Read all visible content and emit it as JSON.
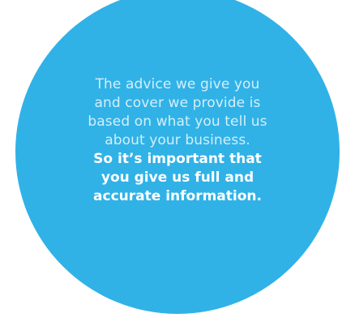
{
  "colors": {
    "circle": "#30b2e7",
    "light_text": "#d4eefa",
    "bold_text": "#ffffff",
    "background": "#ffffff"
  },
  "message": {
    "regular_lines": [
      "The advice we give you",
      "and cover we provide is",
      "based on what you tell us",
      "about your business."
    ],
    "emphasis_lines": [
      "So it’s important that",
      "you give us full and",
      "accurate information."
    ]
  }
}
